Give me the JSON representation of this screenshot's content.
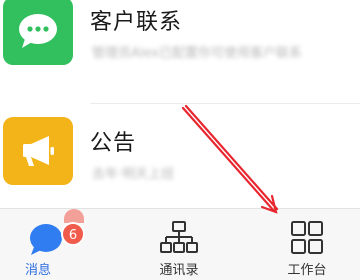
{
  "conversations": [
    {
      "title": "客户联系",
      "preview": "管理员Alex已配置你可使用客户联系",
      "icon": "chat-bubble-icon",
      "icon_color": "#31c05d"
    },
    {
      "title": "公告",
      "preview": "去年·明天上班",
      "icon": "megaphone-icon",
      "icon_color": "#f2b418"
    }
  ],
  "tabbar": {
    "messages_label": "消息",
    "messages_badge": "6",
    "contacts_label": "通讯录",
    "workbench_label": "工作台",
    "active_color": "#2f6fe0",
    "badge_color": "#f05b4b"
  },
  "annotation": {
    "arrow_color": "#e8262f",
    "arrow_target": "tab-workbench"
  }
}
